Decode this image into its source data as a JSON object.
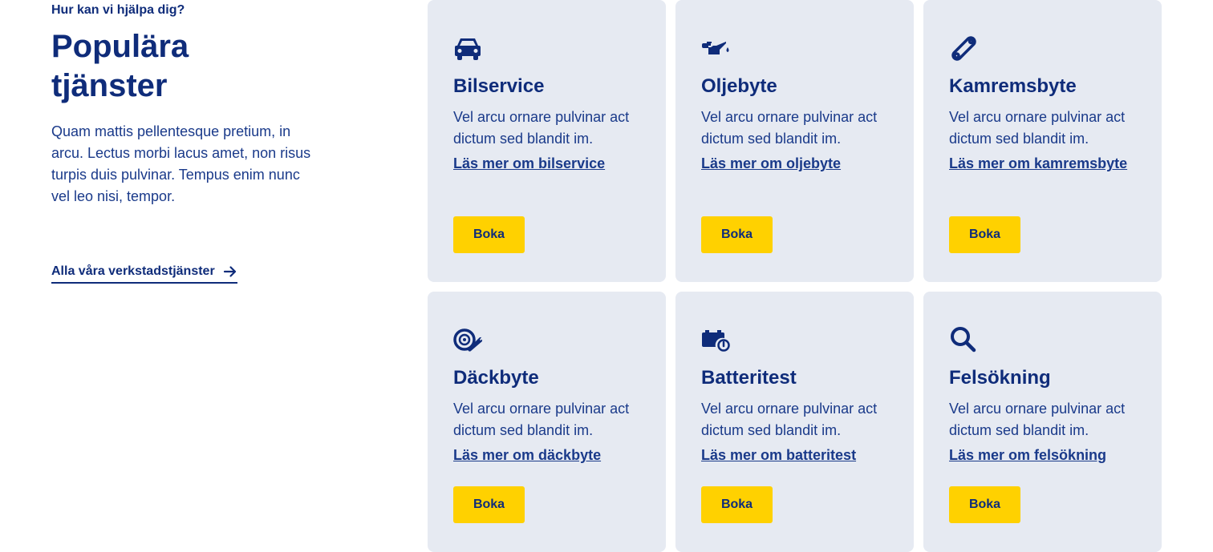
{
  "intro": {
    "eyebrow": "Hur kan vi hjälpa dig?",
    "title": "Populära tjänster",
    "description": "Quam mattis pellentesque pretium, in arcu. Lectus morbi lacus amet, non risus turpis duis pulvinar. Tempus enim nunc vel leo nisi, tempor.",
    "all_link": "Alla våra verkstadstjänster",
    "all_link_icon": "arrow-right-icon"
  },
  "colors": {
    "navy": "#0f2c7a",
    "card_bg": "#e6eaf2",
    "button_yellow": "#ffd100"
  },
  "services": [
    {
      "icon": "car-icon",
      "title": "Bilservice",
      "text": "Vel arcu ornare pulvinar act dictum sed blandit im.",
      "link": "Läs mer om bilservice",
      "button": "Boka"
    },
    {
      "icon": "oil-can-icon",
      "title": "Oljebyte",
      "text": "Vel arcu ornare pulvinar act dictum sed blandit im.",
      "link": "Läs mer om oljebyte",
      "button": "Boka"
    },
    {
      "icon": "timing-belt-icon",
      "title": "Kamremsbyte",
      "text": "Vel arcu ornare pulvinar act dictum sed blandit im.",
      "link": "Läs mer om kamremsbyte",
      "button": "Boka"
    },
    {
      "icon": "tire-wrench-icon",
      "title": "Däckbyte",
      "text": "Vel arcu ornare pulvinar act dictum sed blandit im.",
      "link": "Läs mer om däckbyte",
      "button": "Boka"
    },
    {
      "icon": "battery-test-icon",
      "title": "Batteritest",
      "text": "Vel arcu ornare pulvinar act dictum sed blandit im.",
      "link": "Läs mer om batteritest",
      "button": "Boka"
    },
    {
      "icon": "magnifier-icon",
      "title": "Felsökning",
      "text": "Vel arcu ornare pulvinar act dictum sed blandit im.",
      "link": "Läs mer om felsökning",
      "button": "Boka"
    }
  ]
}
